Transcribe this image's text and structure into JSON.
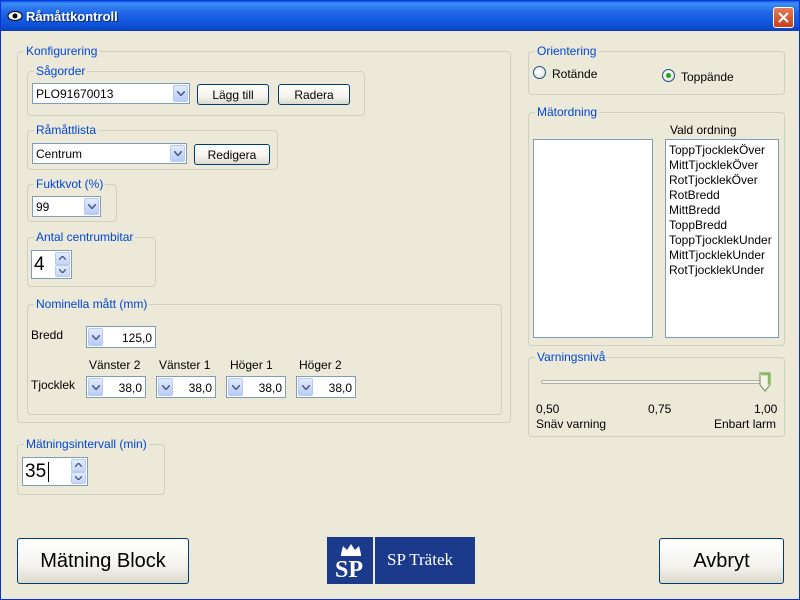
{
  "window": {
    "title": "Råmåttkontroll"
  },
  "sagorder": {
    "legend": "Sågorder",
    "value": "PLO91670013",
    "add_label": "Lägg till",
    "delete_label": "Radera"
  },
  "konfig": {
    "legend": "Konfigurering"
  },
  "ramattlista": {
    "legend": "Råmåttlista",
    "value": "Centrum",
    "edit_label": "Redigera"
  },
  "fuktkvot": {
    "legend": "Fuktkvot (%)",
    "value": "99"
  },
  "centrumbitar": {
    "legend": "Antal centrumbitar",
    "value": "4"
  },
  "nominella": {
    "legend": "Nominella mått (mm)",
    "bredd_label": "Bredd",
    "bredd_value": "125,0",
    "tjocklek_label": "Tjocklek",
    "columns": [
      {
        "header": "Vänster 2",
        "value": "38,0"
      },
      {
        "header": "Vänster 1",
        "value": "38,0"
      },
      {
        "header": "Höger 1",
        "value": "38,0"
      },
      {
        "header": "Höger 2",
        "value": "38,0"
      }
    ]
  },
  "matintervall": {
    "legend": "Mätningsintervall (min)",
    "value": "35"
  },
  "orientering": {
    "legend": "Orientering",
    "option_rot": "Rotände",
    "option_topp": "Toppände",
    "selected": "Toppände"
  },
  "matordning": {
    "legend": "Mätordning",
    "vald_label": "Vald ordning",
    "available": [],
    "selected": [
      "ToppTjocklekÖver",
      "MittTjocklekÖver",
      "RotTjocklekÖver",
      "RotBredd",
      "MittBredd",
      "ToppBredd",
      "ToppTjocklekUnder",
      "MittTjocklekUnder",
      "RotTjocklekUnder"
    ]
  },
  "varningsniva": {
    "legend": "Varningsnivå",
    "min_label": "0,50",
    "mid_label": "0,75",
    "max_label": "1,00",
    "left_caption": "Snäv varning",
    "right_caption": "Enbart larm",
    "value": 1.0
  },
  "buttons": {
    "matning": "Mätning Block",
    "avbryt": "Avbryt"
  },
  "logo": {
    "mark": "SP",
    "text": "SP Trätek"
  },
  "colors": {
    "titlebar": "#0A5EE8",
    "legend": "#0046D5",
    "window_bg": "#ECE9D8",
    "logo_bg": "#1B3A8C"
  }
}
